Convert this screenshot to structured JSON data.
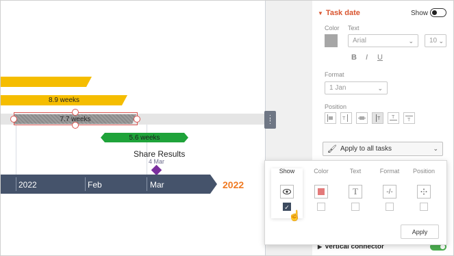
{
  "gantt": {
    "bars": [
      {
        "label": ""
      },
      {
        "label": "8.9 weeks"
      },
      {
        "label": "7.7 weeks"
      },
      {
        "label": "5.6 weeks"
      }
    ],
    "milestone": {
      "title": "Share Results",
      "date": "4 Mar"
    },
    "timeline": {
      "labels": [
        "2022",
        "Feb",
        "Mar"
      ],
      "year": "2022"
    },
    "colors": {
      "task_yellow": "#f5bd00",
      "task_green": "#1fa33a",
      "timeline": "#45536b",
      "milestone": "#7a2f9e",
      "year": "#f07a22"
    }
  },
  "panel": {
    "section_title": "Task date",
    "show_label": "Show",
    "color_label": "Color",
    "text_label": "Text",
    "font_value": "Arial",
    "size_value": "10",
    "format_buttons": [
      "B",
      "I",
      "U"
    ],
    "format_label": "Format",
    "format_value": "1 Jan",
    "position_label": "Position",
    "apply_all_label": "Apply to all tasks",
    "vertical_connector_label": "Vertical connector"
  },
  "popup": {
    "columns": [
      {
        "header": "Show",
        "icon": "eye-icon",
        "checked": true
      },
      {
        "header": "Color",
        "icon": "color-swatch-icon",
        "checked": false
      },
      {
        "header": "Text",
        "icon": "text-icon",
        "checked": false
      },
      {
        "header": "Format",
        "icon": "format-icon",
        "glyph": "-/-",
        "checked": false
      },
      {
        "header": "Position",
        "icon": "position-icon",
        "checked": false
      }
    ],
    "apply_label": "Apply"
  }
}
